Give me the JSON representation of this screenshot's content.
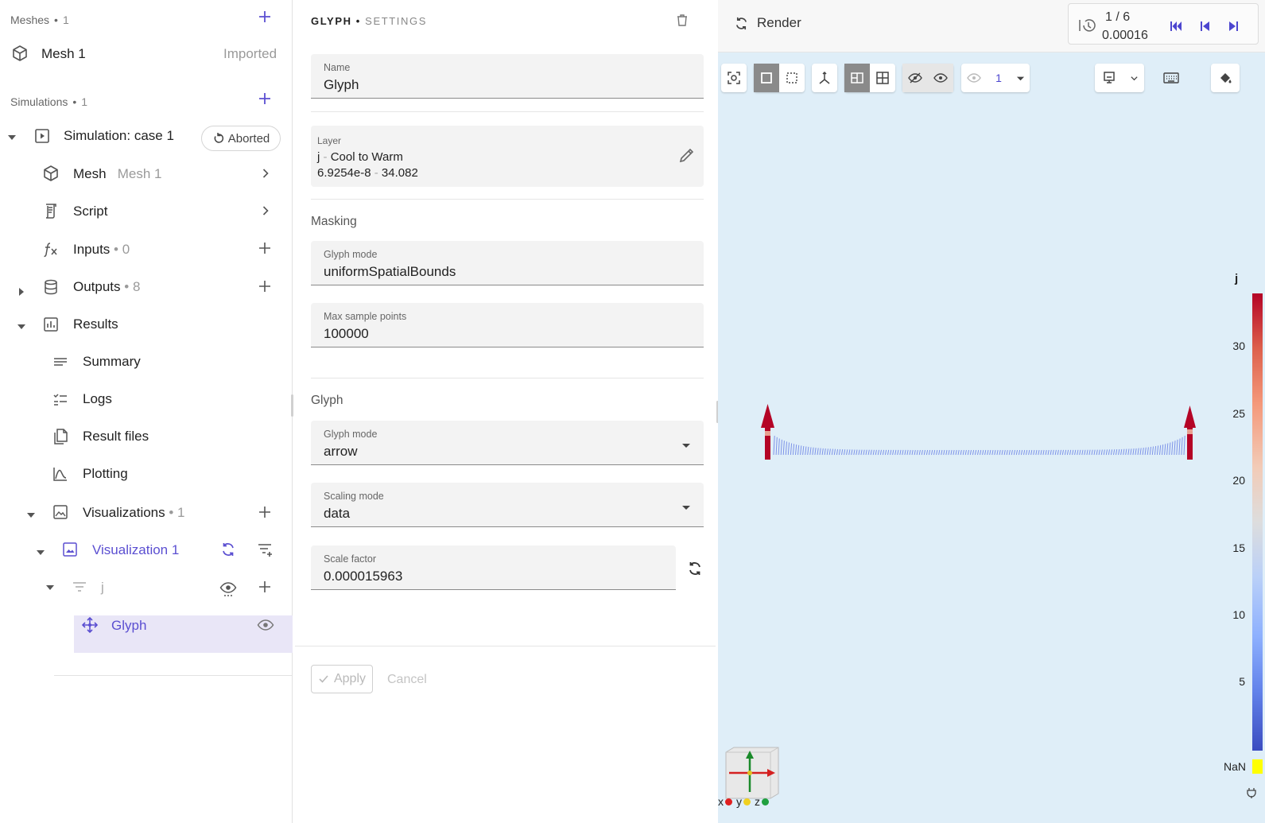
{
  "sidebar": {
    "meshes_header": {
      "label": "Meshes",
      "count": "1"
    },
    "mesh_item": {
      "label": "Mesh 1",
      "status": "Imported"
    },
    "simulations_header": {
      "label": "Simulations",
      "count": "1"
    },
    "simulation": {
      "label": "Simulation: case 1",
      "badge": "Aborted"
    },
    "mesh_row": {
      "label": "Mesh",
      "value": "Mesh 1"
    },
    "script_row": {
      "label": "Script"
    },
    "inputs_row": {
      "label": "Inputs",
      "count": "0"
    },
    "outputs_row": {
      "label": "Outputs",
      "count": "8"
    },
    "results_row": {
      "label": "Results"
    },
    "summary_row": {
      "label": "Summary"
    },
    "logs_row": {
      "label": "Logs"
    },
    "result_files_row": {
      "label": "Result files"
    },
    "plotting_row": {
      "label": "Plotting"
    },
    "visualizations_row": {
      "label": "Visualizations",
      "count": "1"
    },
    "visualization_item": {
      "label": "Visualization 1"
    },
    "filter_item": {
      "label": "j"
    },
    "glyph_item": {
      "label": "Glyph"
    }
  },
  "panel": {
    "title_bold": "GLYPH",
    "title_light": "SETTINGS",
    "name_field": {
      "label": "Name",
      "value": "Glyph"
    },
    "layer": {
      "label": "Layer",
      "field": "j",
      "colormap": "Cool to Warm",
      "min": "6.9254e-8",
      "max": "34.082"
    },
    "masking_label": "Masking",
    "masking_glyph_mode": {
      "label": "Glyph mode",
      "value": "uniformSpatialBounds"
    },
    "max_sample_points": {
      "label": "Max sample points",
      "value": "100000"
    },
    "glyph_label": "Glyph",
    "glyph_mode": {
      "label": "Glyph mode",
      "value": "arrow"
    },
    "scaling_mode": {
      "label": "Scaling mode",
      "value": "data"
    },
    "scale_factor": {
      "label": "Scale factor",
      "value": "0.000015963"
    },
    "apply_label": "Apply",
    "cancel_label": "Cancel"
  },
  "viewport": {
    "render_label": "Render",
    "frame": "1 / 6",
    "time": "0.00016",
    "view_count": "1",
    "colorbar": {
      "title": "j",
      "ticks": [
        "30",
        "25",
        "20",
        "15",
        "10",
        "5"
      ],
      "nan_label": "NaN",
      "colormap": [
        "#3b4cc0",
        "#dddddd",
        "#b40426"
      ],
      "range": [
        6.9254e-08,
        34.082
      ]
    },
    "axes": {
      "x": "x",
      "y": "y",
      "z": "z",
      "x_color": "#e02020",
      "y_color": "#f0d020",
      "z_color": "#20a040"
    }
  },
  "colors": {
    "accent": "#5b4fd1",
    "selected_bg": "#e9e6f7",
    "viewport_bg": "#dfeef8"
  }
}
